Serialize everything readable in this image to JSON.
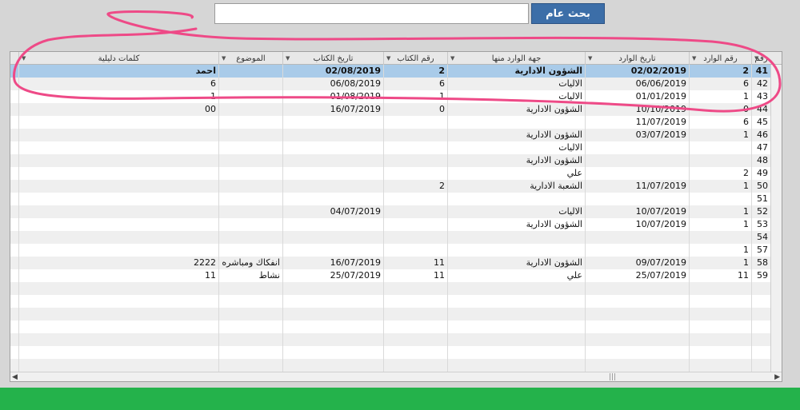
{
  "search": {
    "button_label": "بحث عام",
    "value": ""
  },
  "columns": [
    {
      "label": "رقم"
    },
    {
      "label": "رقم الوارد"
    },
    {
      "label": "تاريخ الوارد"
    },
    {
      "label": "جهة الوارد منها"
    },
    {
      "label": "رقم الكتاب"
    },
    {
      "label": "تاريخ الكتاب"
    },
    {
      "label": "الموضوع"
    },
    {
      "label": "كلمات دليلية"
    }
  ],
  "rows": [
    [
      "41",
      "2",
      "02/02/2019",
      "الشؤون الادارية",
      "2",
      "02/08/2019",
      "",
      "احمد"
    ],
    [
      "42",
      "6",
      "06/06/2019",
      "الاليات",
      "6",
      "06/08/2019",
      "",
      "6"
    ],
    [
      "43",
      "1",
      "01/01/2019",
      "الاليات",
      "1",
      "01/08/2019",
      "",
      "1"
    ],
    [
      "44",
      "0",
      "10/10/2019",
      "الشؤون الادارية",
      "0",
      "16/07/2019",
      "",
      "00"
    ],
    [
      "45",
      "6",
      "11/07/2019",
      "",
      "",
      "",
      "",
      ""
    ],
    [
      "46",
      "1",
      "03/07/2019",
      "الشؤون الادارية",
      "",
      "",
      "",
      ""
    ],
    [
      "47",
      "",
      "",
      "الاليات",
      "",
      "",
      "",
      ""
    ],
    [
      "48",
      "",
      "",
      "الشؤون الادارية",
      "",
      "",
      "",
      ""
    ],
    [
      "49",
      "2",
      "",
      "علي",
      "",
      "",
      "",
      ""
    ],
    [
      "50",
      "1",
      "11/07/2019",
      "الشعبة الادارية",
      "2",
      "",
      "",
      ""
    ],
    [
      "51",
      "",
      "",
      "",
      "",
      "",
      "",
      ""
    ],
    [
      "52",
      "1",
      "10/07/2019",
      "الاليات",
      "",
      "04/07/2019",
      "",
      ""
    ],
    [
      "53",
      "1",
      "10/07/2019",
      "الشؤون الادارية",
      "",
      "",
      "",
      ""
    ],
    [
      "54",
      "",
      "",
      "",
      "",
      "",
      "",
      ""
    ],
    [
      "57",
      "1",
      "",
      "",
      "",
      "",
      "",
      ""
    ],
    [
      "58",
      "1",
      "09/07/2019",
      "الشؤون الادارية",
      "11",
      "16/07/2019",
      "انفكاك ومباشره",
      "2222"
    ],
    [
      "59",
      "11",
      "25/07/2019",
      "علي",
      "11",
      "25/07/2019",
      "نشاط",
      "11"
    ]
  ],
  "selected_row": 0
}
